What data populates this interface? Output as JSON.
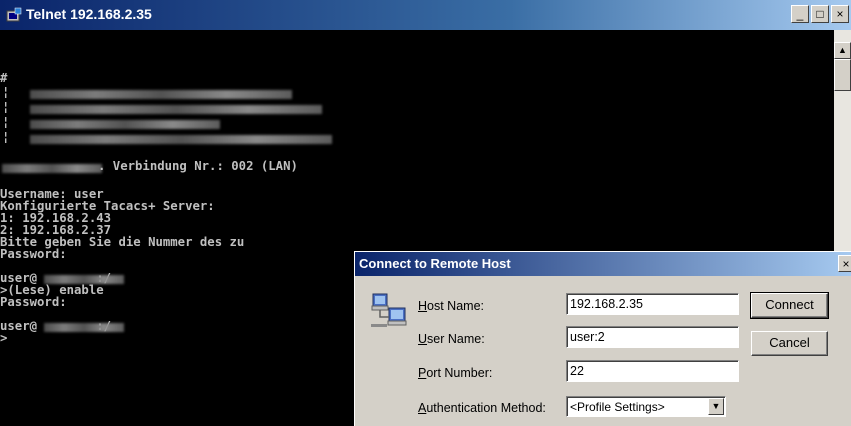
{
  "window": {
    "title": "Telnet 192.168.2.35",
    "controls": {
      "minimize": "_",
      "maximize": "□",
      "close": "×"
    }
  },
  "terminal": {
    "lines": [
      "#",
      "",
      "",
      "",
      "",
      "",
      ". Verbindung Nr.: 002 (LAN)",
      "",
      "Username: user",
      "Konfigurierte Tacacs+ Server:",
      "1: 192.168.2.43",
      "2: 192.168.2.37",
      "Bitte geben Sie die Nummer des zu",
      "Password:",
      "",
      "user@        :/",
      ">(Lese) enable",
      "Password:",
      "",
      "user@        :/",
      ">"
    ]
  },
  "dialog": {
    "title": "Connect to Remote Host",
    "close": "×",
    "host_label_accel": "H",
    "host_label_rest": "ost Name:",
    "host_value": "192.168.2.35",
    "user_label_accel": "U",
    "user_label_rest": "ser Name:",
    "user_value": "user:2",
    "port_label_accel": "P",
    "port_label_rest": "ort Number:",
    "port_value": "22",
    "auth_label_accel": "A",
    "auth_label_rest": "uthentication Method:",
    "auth_value": "<Profile Settings>",
    "connect_label": "Connect",
    "cancel_label": "Cancel"
  }
}
